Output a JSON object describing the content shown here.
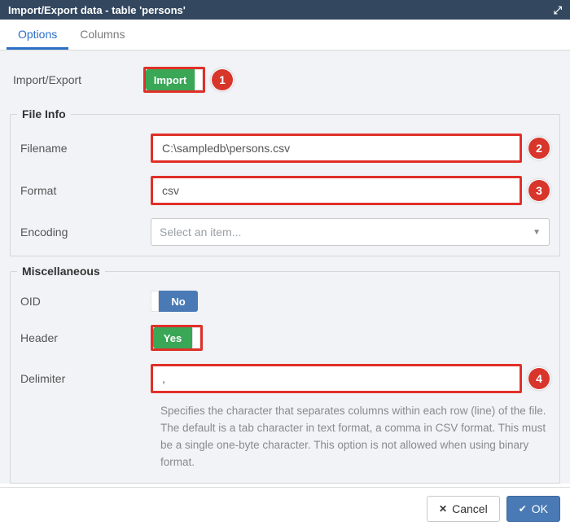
{
  "window": {
    "title": "Import/Export data - table 'persons'"
  },
  "tabs": [
    {
      "label": "Options",
      "active": true
    },
    {
      "label": "Columns",
      "active": false
    }
  ],
  "options": {
    "importExport": {
      "label": "Import/Export",
      "value": "Import"
    }
  },
  "fileInfo": {
    "legend": "File Info",
    "filename": {
      "label": "Filename",
      "value": "C:\\sampledb\\persons.csv"
    },
    "format": {
      "label": "Format",
      "value": "csv"
    },
    "encoding": {
      "label": "Encoding",
      "placeholder": "Select an item..."
    }
  },
  "misc": {
    "legend": "Miscellaneous",
    "oid": {
      "label": "OID",
      "value": "No"
    },
    "header": {
      "label": "Header",
      "value": "Yes"
    },
    "delimiter": {
      "label": "Delimiter",
      "value": ",",
      "help": "Specifies the character that separates columns within each row (line) of the file. The default is a tab character in text format, a comma in CSV format. This must be a single one-byte character. This option is not allowed when using binary format."
    }
  },
  "callouts": {
    "c1": "1",
    "c2": "2",
    "c3": "3",
    "c4": "4"
  },
  "footer": {
    "cancel": "Cancel",
    "ok": "OK"
  }
}
